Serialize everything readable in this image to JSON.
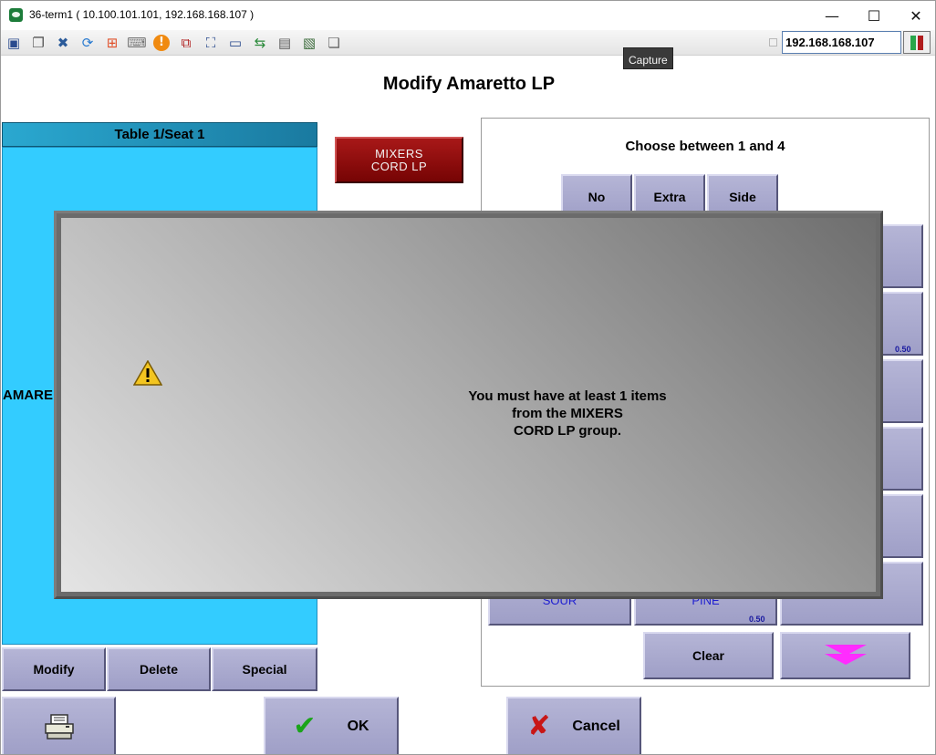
{
  "window": {
    "title": "36-term1 ( 10.100.101.101, 192.168.168.107 )",
    "minimize": "—",
    "maximize": "☐",
    "close": "✕"
  },
  "toolbar": {
    "icons": [
      "monitor-icon",
      "windows-icon",
      "tools-icon",
      "refresh-icon",
      "windows-logo-icon",
      "keyboard-icon",
      "alert-icon",
      "network-icon",
      "fullscreen-icon",
      "display-icon",
      "transfer-icon",
      "notepad-icon",
      "capture-icon",
      "chat-icon"
    ],
    "ip_value": "192.168.168.107",
    "tooltip": "Capture"
  },
  "page": {
    "title": "Modify Amaretto LP"
  },
  "left_panel": {
    "header": "Table 1/Seat 1",
    "item": "AMARE",
    "buttons": [
      "Modify",
      "Delete",
      "Special"
    ]
  },
  "group_button": {
    "line1": "MIXERS",
    "line2": "CORD LP"
  },
  "modifier_panel": {
    "prompt": "Choose between 1 and 4",
    "options": [
      "No",
      "Extra",
      "Side"
    ],
    "items": [
      {
        "label": "SOUR",
        "price": ""
      },
      {
        "label": "PINE",
        "price": "0.50"
      }
    ],
    "right_price": "0.50",
    "clear_label": "Clear"
  },
  "modal": {
    "message_line1": "You must have at least 1 items",
    "message_line2": "from the MIXERS",
    "message_line3": "CORD LP group."
  },
  "bottom": {
    "ok_label": "OK",
    "cancel_label": "Cancel"
  },
  "colors": {
    "seat_panel": "#33ccff",
    "group_button": "#8b0d0d",
    "button": "#a8a8cc",
    "arrow": "#ff2cff"
  }
}
